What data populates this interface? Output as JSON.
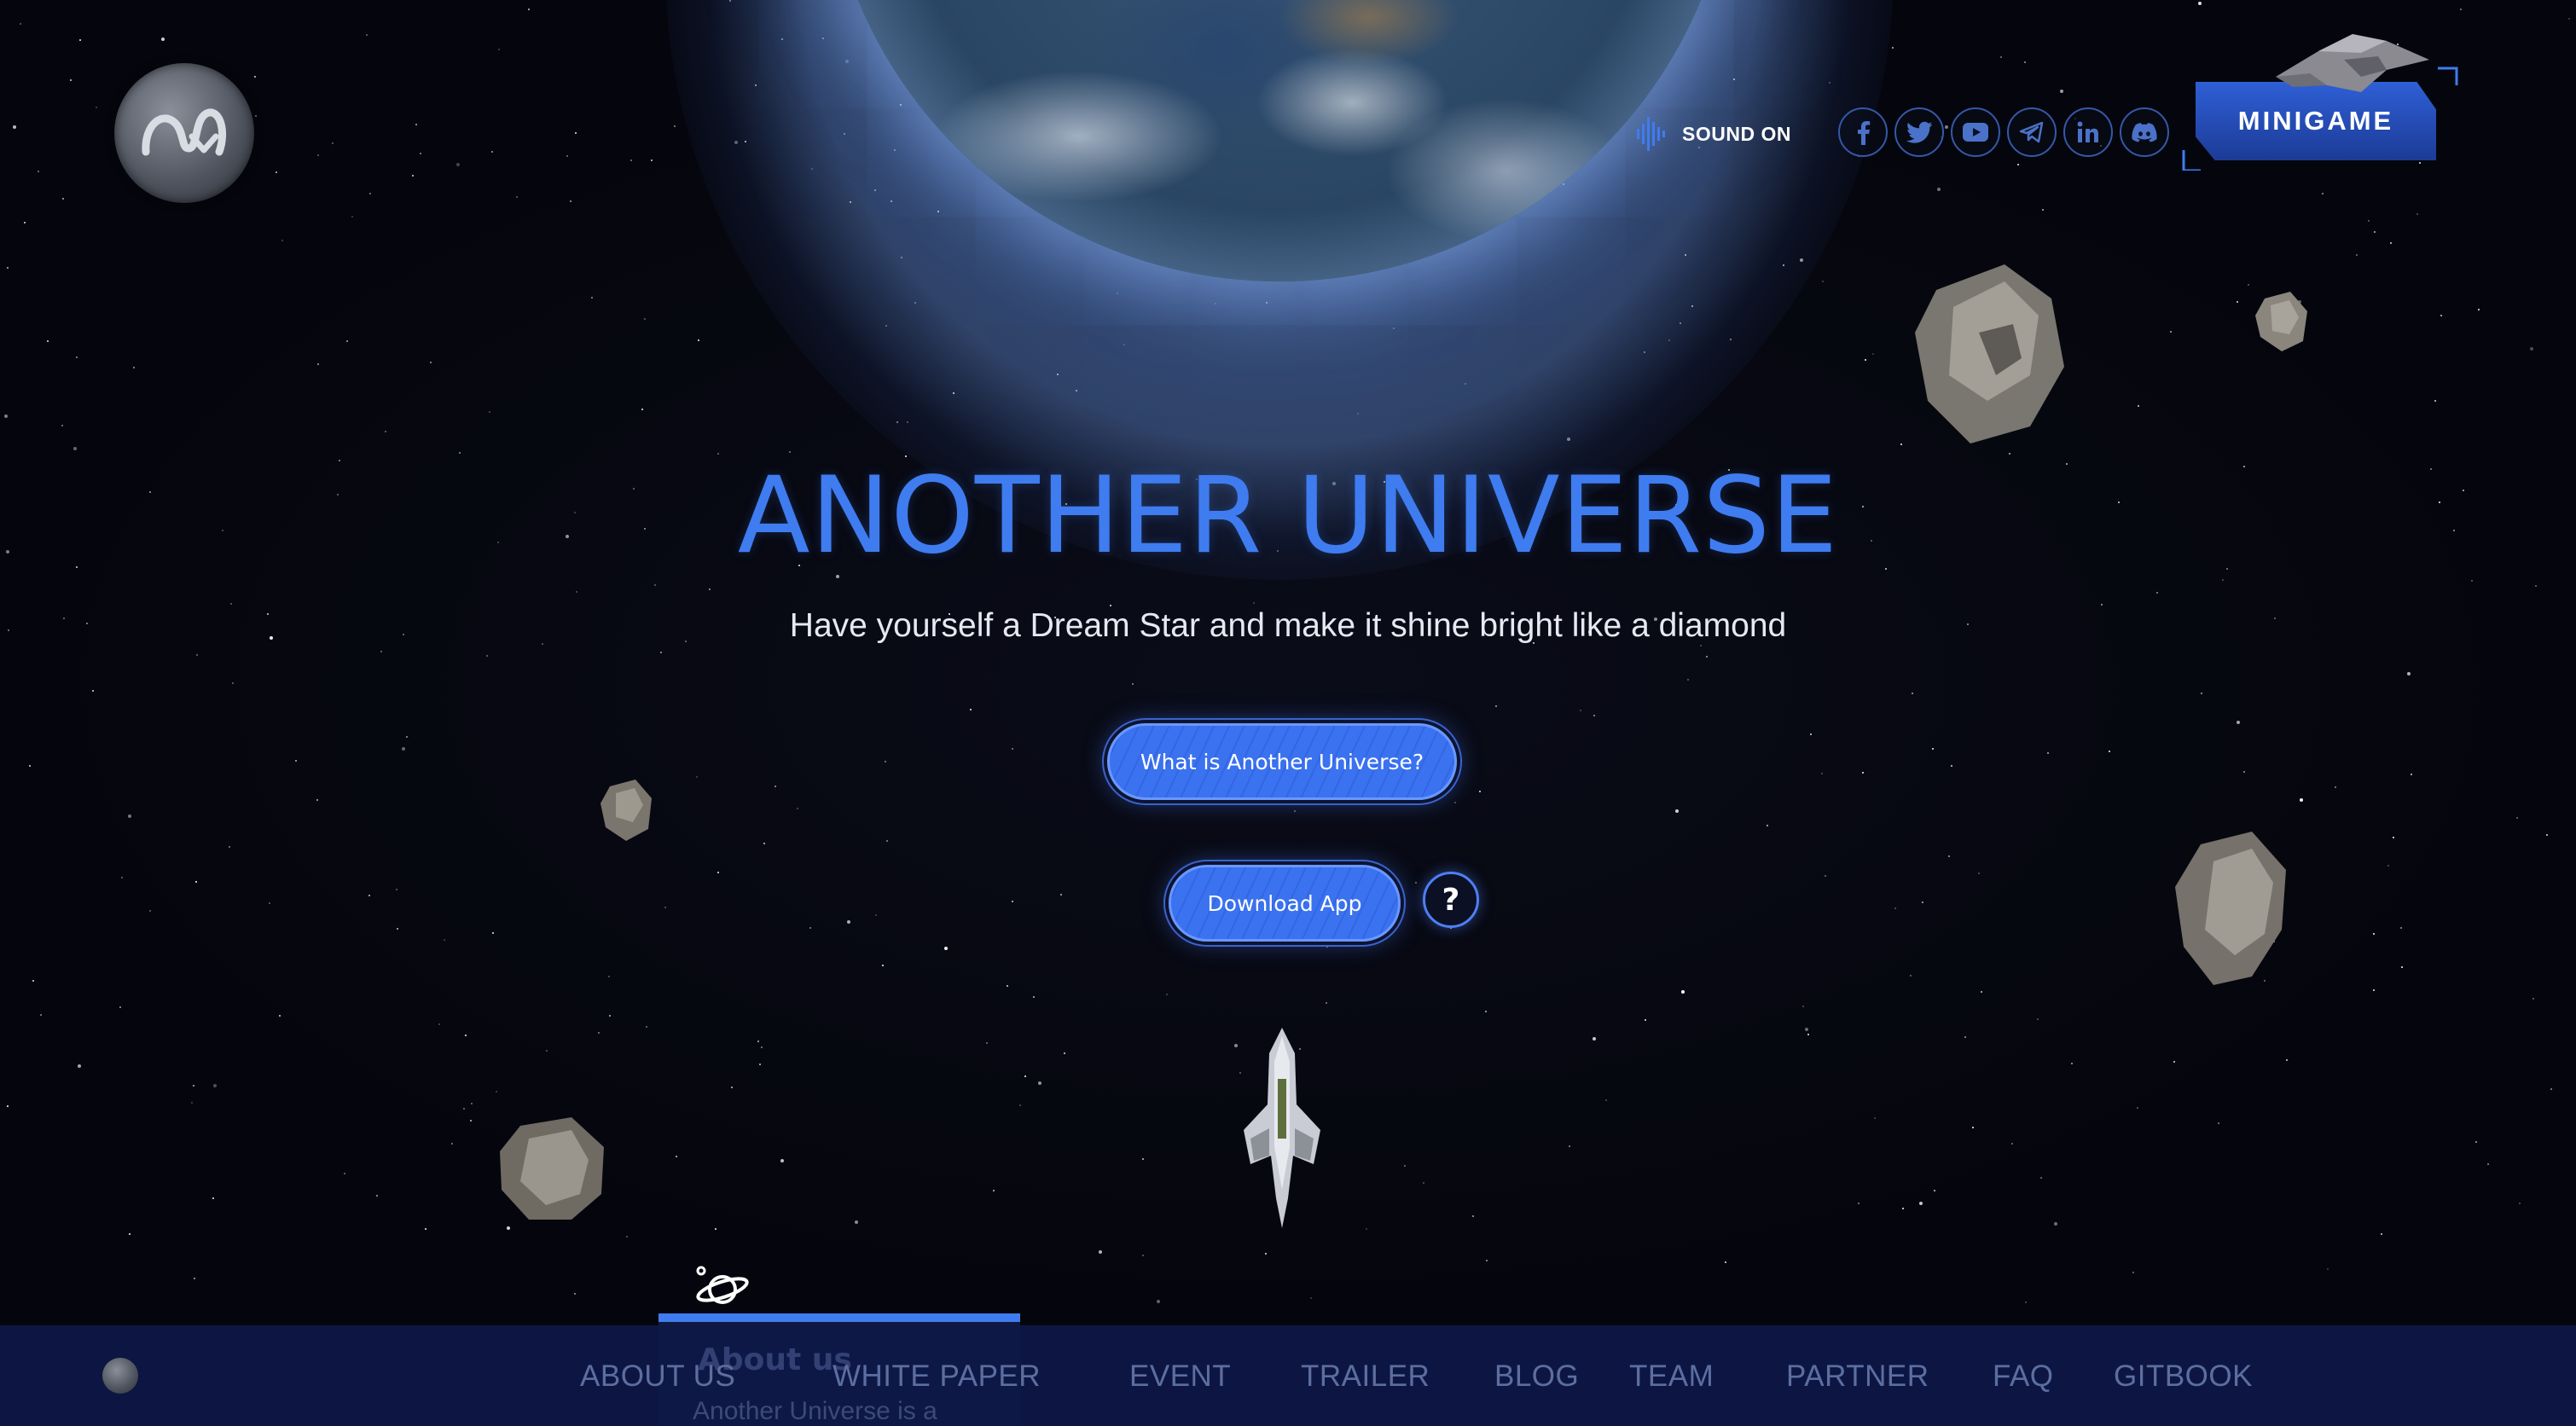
{
  "brand": {
    "logo_icon": "another-universe-logo-icon"
  },
  "header": {
    "sound_label": "SOUND ON",
    "sound_icon": "sound-wave-icon",
    "minigame_label": "MINIGAME",
    "socials": [
      {
        "name": "facebook",
        "icon": "facebook-icon"
      },
      {
        "name": "twitter",
        "icon": "twitter-icon"
      },
      {
        "name": "youtube",
        "icon": "youtube-icon"
      },
      {
        "name": "telegram",
        "icon": "telegram-icon"
      },
      {
        "name": "linkedin",
        "icon": "linkedin-icon"
      },
      {
        "name": "discord",
        "icon": "discord-icon"
      }
    ]
  },
  "hero": {
    "title": "ANOTHER UNIVERSE",
    "subtitle": "Have yourself a Dream Star and make it shine bright like a diamond",
    "primary_button": "What is Another Universe?",
    "download_button": "Download App",
    "help_label": "?"
  },
  "section_preview": {
    "icon": "planet-icon",
    "title": "About us",
    "text": "Another Universe is a"
  },
  "nav": {
    "items": [
      "ABOUT US",
      "WHITE PAPER",
      "EVENT",
      "TRAILER",
      "BLOG",
      "TEAM",
      "PARTNER",
      "FAQ",
      "GITBOOK"
    ]
  },
  "colors": {
    "accent": "#3f7cf0",
    "nav_bg": "#0e1848",
    "background": "#05060d"
  }
}
